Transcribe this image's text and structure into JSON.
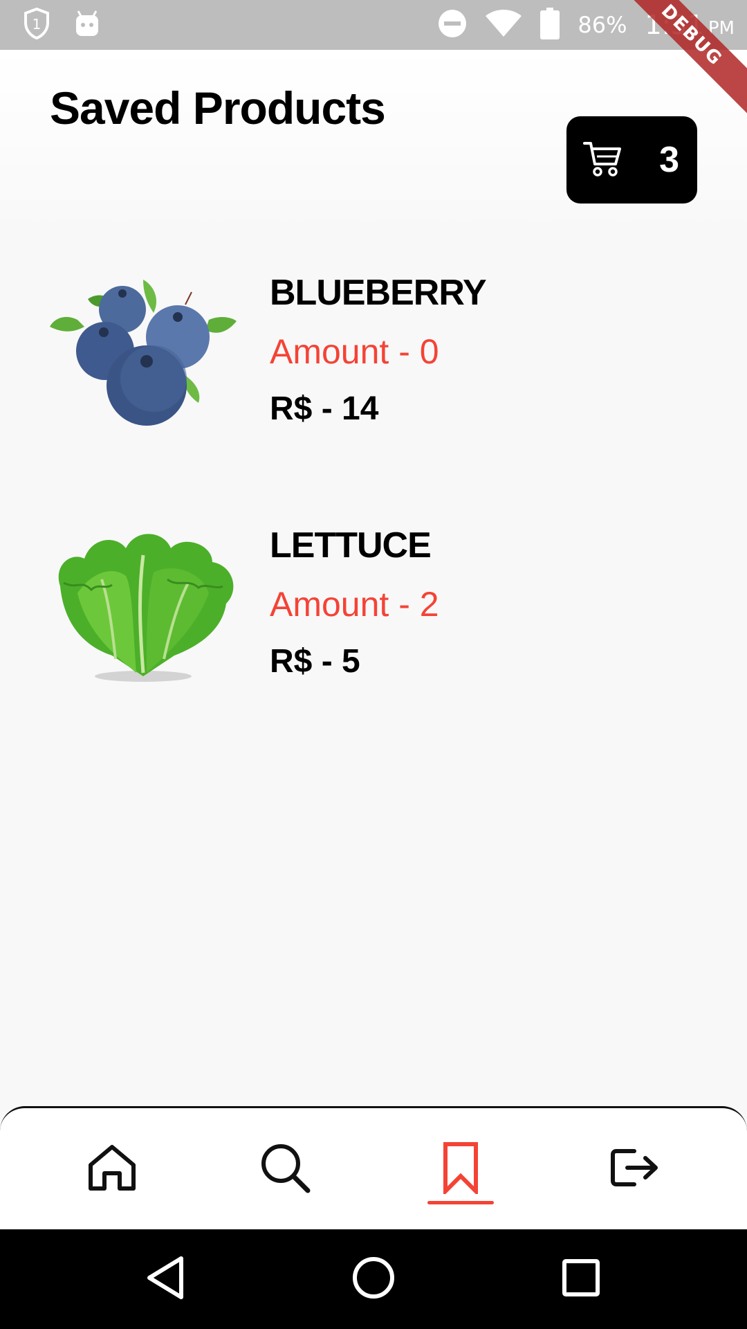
{
  "status_bar": {
    "battery": "86%",
    "time": "1:31",
    "ampm": "PM",
    "debug_label": "DEBUG"
  },
  "header": {
    "title": "Saved Products",
    "cart_count": "3"
  },
  "products": [
    {
      "name": "BLUEBERRY",
      "amount": "Amount - 0",
      "price": "R$ - 14"
    },
    {
      "name": "LETTUCE",
      "amount": "Amount - 2",
      "price": "R$ - 5"
    }
  ],
  "bottom_nav": {
    "items": [
      "home-icon",
      "search-icon",
      "bookmark-icon",
      "logout-icon"
    ],
    "active": "bookmark-icon"
  },
  "colors": {
    "accent": "#f44336",
    "background": "#f8f8f8",
    "status_bar": "#bdbdbd"
  }
}
